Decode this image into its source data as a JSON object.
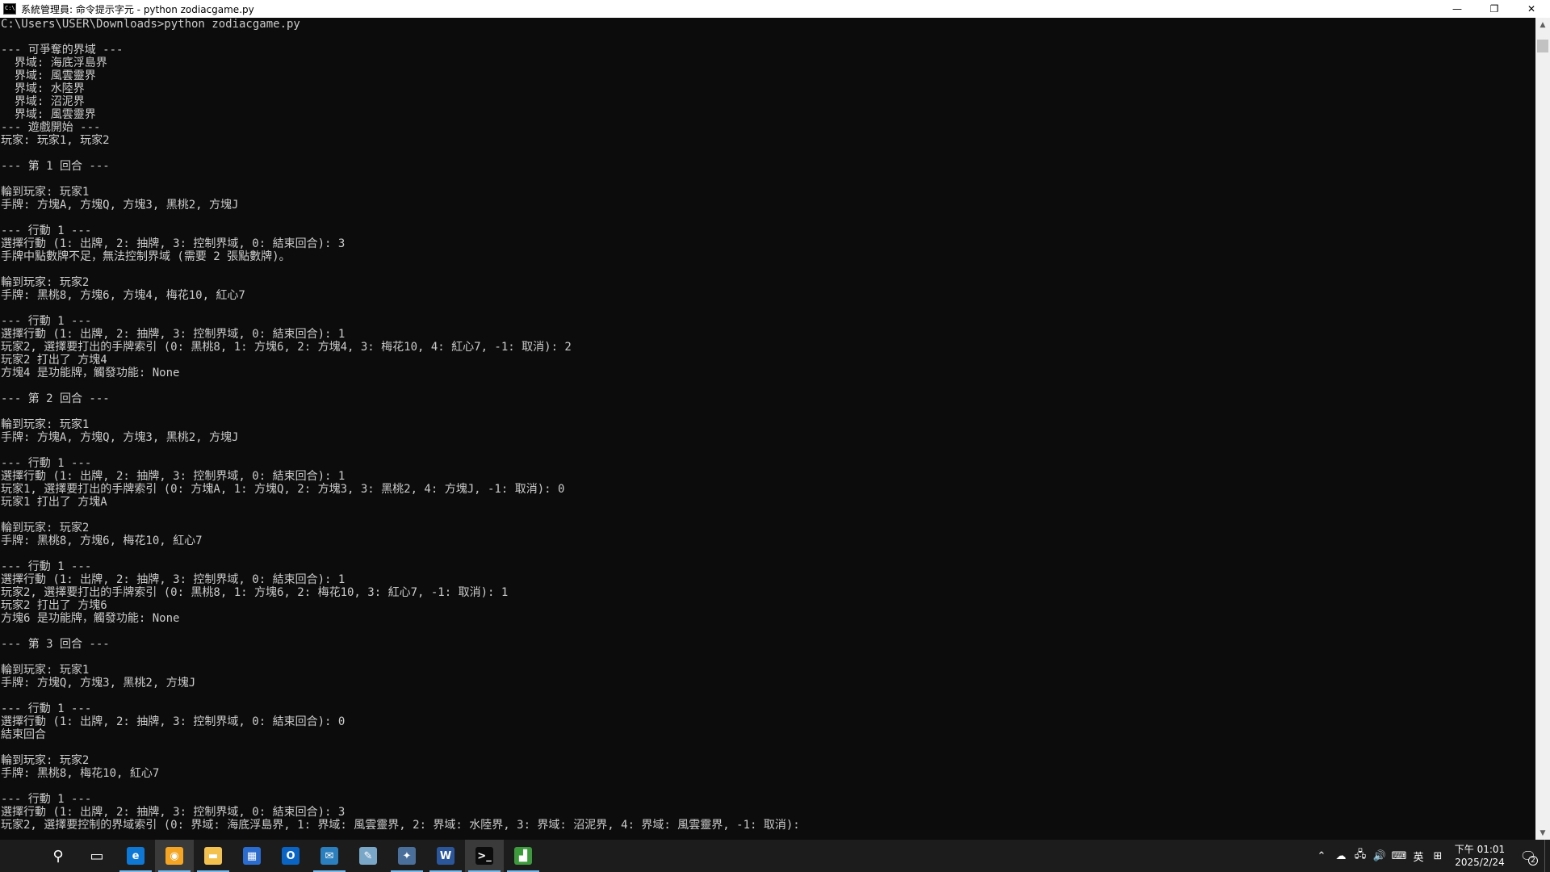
{
  "window": {
    "title": "系統管理員: 命令提示字元 - python  zodiacgame.py",
    "minimize_glyph": "—",
    "restore_glyph": "❐",
    "close_glyph": "✕"
  },
  "console": {
    "lines": [
      "C:\\Users\\USER\\Downloads>python zodiacgame.py",
      "",
      "--- 可爭奪的界域 ---",
      "  界域: 海底浮島界",
      "  界域: 風雲靈界",
      "  界域: 水陸界",
      "  界域: 沼泥界",
      "  界域: 風雲靈界",
      "--- 遊戲開始 ---",
      "玩家: 玩家1, 玩家2",
      "",
      "--- 第 1 回合 ---",
      "",
      "輪到玩家: 玩家1",
      "手牌: 方塊A, 方塊Q, 方塊3, 黑桃2, 方塊J",
      "",
      "--- 行動 1 ---",
      "選擇行動 (1: 出牌, 2: 抽牌, 3: 控制界域, 0: 結束回合): 3",
      "手牌中點數牌不足，無法控制界域 (需要 2 張點數牌)。",
      "",
      "輪到玩家: 玩家2",
      "手牌: 黑桃8, 方塊6, 方塊4, 梅花10, 紅心7",
      "",
      "--- 行動 1 ---",
      "選擇行動 (1: 出牌, 2: 抽牌, 3: 控制界域, 0: 結束回合): 1",
      "玩家2, 選擇要打出的手牌索引 (0: 黑桃8, 1: 方塊6, 2: 方塊4, 3: 梅花10, 4: 紅心7, -1: 取消): 2",
      "玩家2 打出了 方塊4",
      "方塊4 是功能牌，觸發功能: None",
      "",
      "--- 第 2 回合 ---",
      "",
      "輪到玩家: 玩家1",
      "手牌: 方塊A, 方塊Q, 方塊3, 黑桃2, 方塊J",
      "",
      "--- 行動 1 ---",
      "選擇行動 (1: 出牌, 2: 抽牌, 3: 控制界域, 0: 結束回合): 1",
      "玩家1, 選擇要打出的手牌索引 (0: 方塊A, 1: 方塊Q, 2: 方塊3, 3: 黑桃2, 4: 方塊J, -1: 取消): 0",
      "玩家1 打出了 方塊A",
      "",
      "輪到玩家: 玩家2",
      "手牌: 黑桃8, 方塊6, 梅花10, 紅心7",
      "",
      "--- 行動 1 ---",
      "選擇行動 (1: 出牌, 2: 抽牌, 3: 控制界域, 0: 結束回合): 1",
      "玩家2, 選擇要打出的手牌索引 (0: 黑桃8, 1: 方塊6, 2: 梅花10, 3: 紅心7, -1: 取消): 1",
      "玩家2 打出了 方塊6",
      "方塊6 是功能牌，觸發功能: None",
      "",
      "--- 第 3 回合 ---",
      "",
      "輪到玩家: 玩家1",
      "手牌: 方塊Q, 方塊3, 黑桃2, 方塊J",
      "",
      "--- 行動 1 ---",
      "選擇行動 (1: 出牌, 2: 抽牌, 3: 控制界域, 0: 結束回合): 0",
      "結束回合",
      "",
      "輪到玩家: 玩家2",
      "手牌: 黑桃8, 梅花10, 紅心7",
      "",
      "--- 行動 1 ---",
      "選擇行動 (1: 出牌, 2: 抽牌, 3: 控制界域, 0: 結束回合): 3",
      "玩家2, 選擇要控制的界域索引 (0: 界域: 海底浮島界, 1: 界域: 風雲靈界, 2: 界域: 水陸界, 3: 界域: 沼泥界, 4: 界域: 風雲靈界, -1: 取消):"
    ]
  },
  "scrollbar": {
    "up_glyph": "▲",
    "down_glyph": "▼"
  },
  "taskbar": {
    "items": [
      {
        "name": "start-button",
        "icon": "windows-start-icon",
        "glyph": "",
        "color": "#ffffff",
        "running": false,
        "active": false
      },
      {
        "name": "search-button",
        "icon": "search-icon",
        "glyph": "⚲",
        "color": "#1c1c1c",
        "running": false,
        "active": false
      },
      {
        "name": "task-view-button",
        "icon": "task-view-icon",
        "glyph": "▭",
        "color": "#1c1c1c",
        "running": false,
        "active": false
      },
      {
        "name": "taskbar-edge",
        "icon": "edge-icon",
        "glyph": "e",
        "color": "#0f78d4",
        "running": true,
        "active": false
      },
      {
        "name": "taskbar-chrome",
        "icon": "chrome-canary-icon",
        "glyph": "◉",
        "color": "#f4a524",
        "running": true,
        "active": true
      },
      {
        "name": "taskbar-file-explorer",
        "icon": "folder-icon",
        "glyph": "▬",
        "color": "#f2c14e",
        "running": true,
        "active": false
      },
      {
        "name": "taskbar-store",
        "icon": "store-icon",
        "glyph": "▦",
        "color": "#2b6cd1",
        "running": false,
        "active": false
      },
      {
        "name": "taskbar-outlook",
        "icon": "outlook-icon",
        "glyph": "O",
        "color": "#0a64c4",
        "running": false,
        "active": false
      },
      {
        "name": "taskbar-mail-app",
        "icon": "mail-app-icon",
        "glyph": "✉",
        "color": "#2c7fbe",
        "running": true,
        "active": false
      },
      {
        "name": "taskbar-notes-app",
        "icon": "notes-icon",
        "glyph": "✎",
        "color": "#7aa6c8",
        "running": false,
        "active": false
      },
      {
        "name": "taskbar-python-app",
        "icon": "python-icon",
        "glyph": "✦",
        "color": "#4a6f9a",
        "running": true,
        "active": false
      },
      {
        "name": "taskbar-word",
        "icon": "word-icon",
        "glyph": "W",
        "color": "#2b579a",
        "running": true,
        "active": false
      },
      {
        "name": "taskbar-cmd",
        "icon": "command-prompt-icon",
        "glyph": ">_",
        "color": "#0c0c0c",
        "running": true,
        "active": true
      },
      {
        "name": "taskbar-chart-app",
        "icon": "chart-app-icon",
        "glyph": "▟",
        "color": "#3c9a3c",
        "running": true,
        "active": false
      }
    ]
  },
  "tray": {
    "icons": [
      {
        "name": "tray-chevron-up-icon",
        "glyph": "⌃"
      },
      {
        "name": "tray-onedrive-icon",
        "glyph": "☁"
      },
      {
        "name": "tray-network-icon",
        "glyph": "🖧"
      },
      {
        "name": "tray-volume-icon",
        "glyph": "🔊"
      },
      {
        "name": "tray-keyboard-icon",
        "glyph": "⌨"
      },
      {
        "name": "tray-ime-mode-icon",
        "glyph": "英"
      },
      {
        "name": "tray-ime-grid-icon",
        "glyph": "⊞"
      }
    ],
    "time": "下午 01:01",
    "date": "2025/2/24",
    "notification_glyph": "🗨",
    "notification_count": "2"
  }
}
